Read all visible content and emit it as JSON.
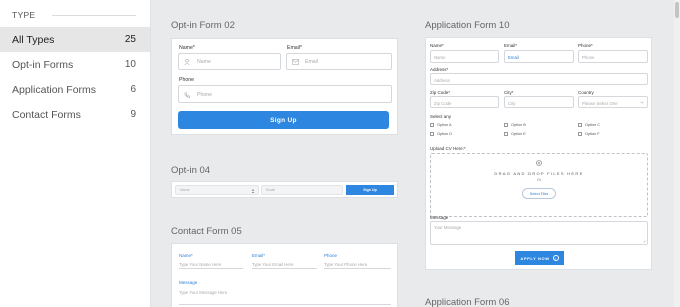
{
  "sidebar": {
    "heading": "TYPE",
    "items": [
      {
        "label": "All Types",
        "count": "25",
        "active": true
      },
      {
        "label": "Opt-in Forms",
        "count": "10"
      },
      {
        "label": "Application Forms",
        "count": "6"
      },
      {
        "label": "Contact Forms",
        "count": "9"
      }
    ]
  },
  "sections": {
    "optin02_title": "Opt-in Form 02",
    "optin04_title": "Opt-in 04",
    "contact05_title": "Contact Form 05",
    "app10_title": "Application Form 10",
    "app06_title": "Application Form 06"
  },
  "optin02": {
    "name_label": "Name*",
    "name_placeholder": "Name",
    "email_label": "Email*",
    "email_placeholder": "Email",
    "phone_label": "Phone",
    "phone_placeholder": "Phone",
    "button": "Sign Up"
  },
  "optin04": {
    "name_placeholder": "Name",
    "email_placeholder": "Email",
    "button": "Sign Up"
  },
  "contact05": {
    "name_label": "Name*",
    "name_placeholder": "Type Your Name Here",
    "email_label": "Email*",
    "email_placeholder": "Type Your Email Here",
    "phone_label": "Phone",
    "phone_placeholder": "Type Your Phone Here",
    "message_label": "Message",
    "message_placeholder": "Type Your Message Here"
  },
  "app10": {
    "name_label": "Name*",
    "name_placeholder": "Name",
    "email_label": "Email*",
    "email_placeholder": "Email",
    "phone_label": "Phone*",
    "phone_placeholder": "Phone",
    "address_label": "Address*",
    "address_placeholder": "Address",
    "zip_label": "Zip Code*",
    "zip_placeholder": "Zip Code",
    "city_label": "City*",
    "city_placeholder": "City",
    "country_label": "Country",
    "country_placeholder": "Please Select One",
    "select_any_label": "Select any",
    "options": [
      "Option A",
      "Option B",
      "Option C",
      "Option D",
      "Option E",
      "Option F"
    ],
    "upload_label": "Upload CV Here:*",
    "drop_text": "DRAG AND DROP FILES HERE",
    "drop_or": "Or",
    "select_files": "Select Files",
    "message_label": "Message",
    "message_placeholder": "Your Message",
    "apply_button": "APPLY NOW"
  },
  "colors": {
    "accent": "#2d86e0",
    "background": "#e8eaec"
  }
}
